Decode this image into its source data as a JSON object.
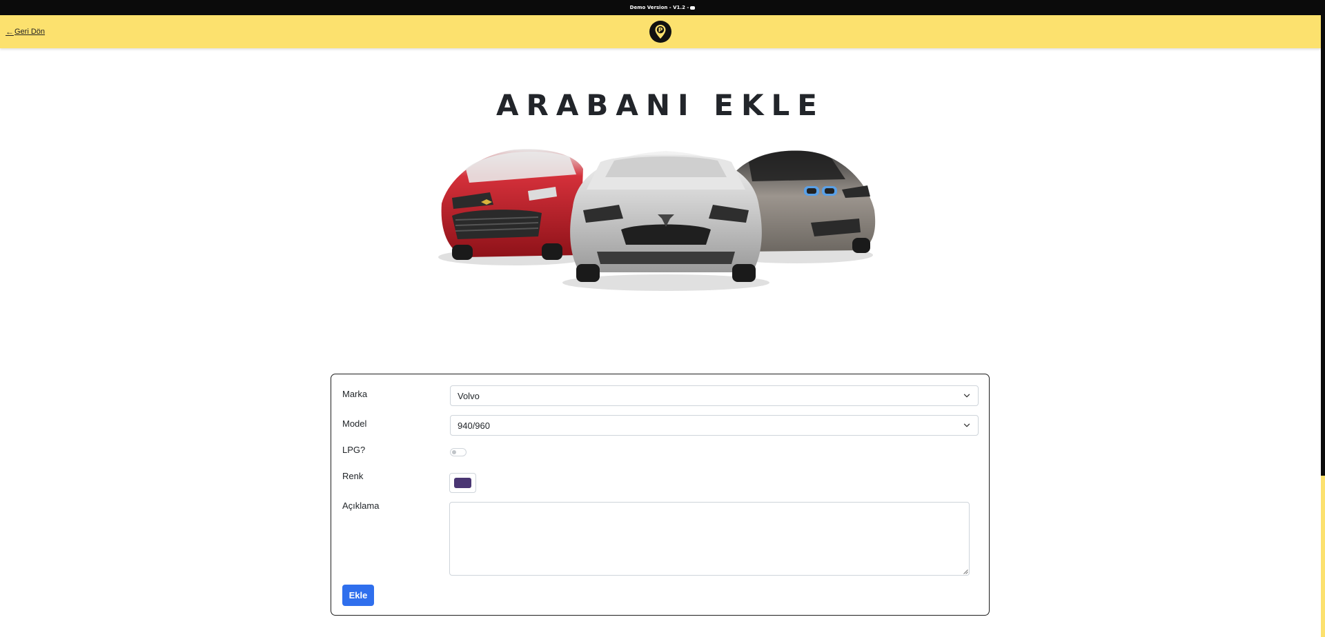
{
  "topbar": {
    "demo_text": "Demo Version - V1.2 -",
    "discord_icon": "discord-icon"
  },
  "navbar": {
    "back_arrow": "←",
    "back_label": "Geri Dön",
    "logo_letter": "P",
    "logo_icon": "parking-pin-logo",
    "background": "#fce16e"
  },
  "page": {
    "title": "ARABANI EKLE",
    "hero_image": "three-cars-illustration"
  },
  "form": {
    "brand": {
      "label": "Marka",
      "value": "Volvo"
    },
    "model": {
      "label": "Model",
      "value": "940/960"
    },
    "lpg": {
      "label": "LPG?",
      "checked": false
    },
    "color": {
      "label": "Renk",
      "value": "#4a3673"
    },
    "description": {
      "label": "Açıklama",
      "value": ""
    },
    "submit_label": "Ekle",
    "submit_color": "#2f6fed"
  }
}
